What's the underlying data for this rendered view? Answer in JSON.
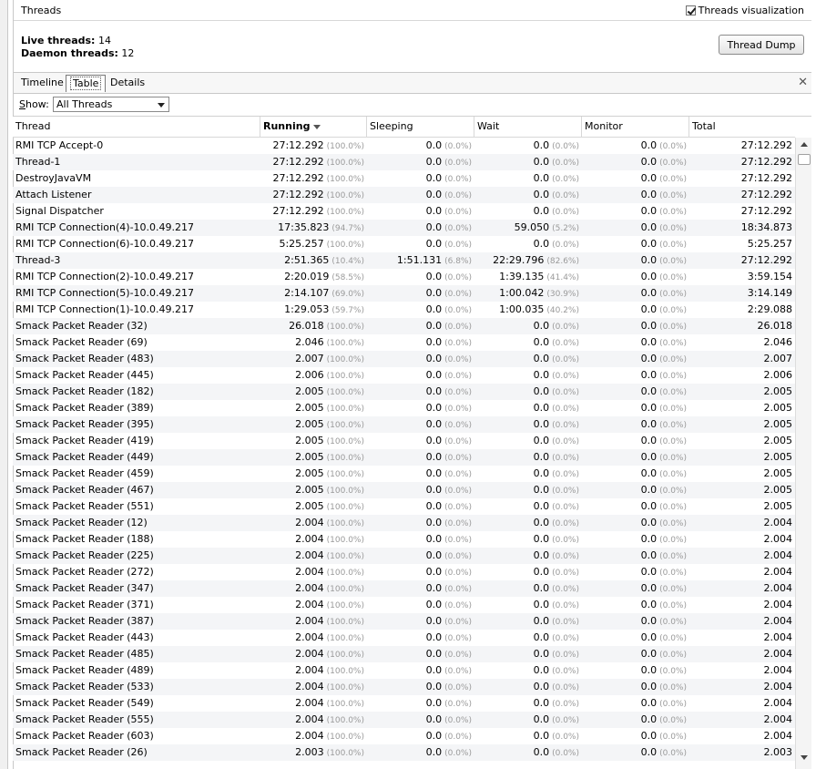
{
  "panel": {
    "title": "Threads",
    "viz_label": "Threads visualization",
    "viz_checked": true
  },
  "summary": {
    "live_label": "Live threads:",
    "live_value": "14",
    "daemon_label": "Daemon threads:",
    "daemon_value": "12"
  },
  "buttons": {
    "thread_dump": "Thread Dump"
  },
  "tabs": [
    "Timeline",
    "Table",
    "Details"
  ],
  "active_tab": "Table",
  "show": {
    "label_prefix": "S",
    "label_rest": "how:",
    "selected": "All Threads"
  },
  "columns": [
    "Thread",
    "Running",
    "Sleeping",
    "Wait",
    "Monitor",
    "Total"
  ],
  "rows": [
    [
      "RMI TCP Accept-0",
      "27:12.292",
      "(100.0%)",
      "0.0",
      "(0.0%)",
      "0.0",
      "(0.0%)",
      "0.0",
      "(0.0%)",
      "27:12.292"
    ],
    [
      "Thread-1",
      "27:12.292",
      "(100.0%)",
      "0.0",
      "(0.0%)",
      "0.0",
      "(0.0%)",
      "0.0",
      "(0.0%)",
      "27:12.292"
    ],
    [
      "DestroyJavaVM",
      "27:12.292",
      "(100.0%)",
      "0.0",
      "(0.0%)",
      "0.0",
      "(0.0%)",
      "0.0",
      "(0.0%)",
      "27:12.292"
    ],
    [
      "Attach Listener",
      "27:12.292",
      "(100.0%)",
      "0.0",
      "(0.0%)",
      "0.0",
      "(0.0%)",
      "0.0",
      "(0.0%)",
      "27:12.292"
    ],
    [
      "Signal Dispatcher",
      "27:12.292",
      "(100.0%)",
      "0.0",
      "(0.0%)",
      "0.0",
      "(0.0%)",
      "0.0",
      "(0.0%)",
      "27:12.292"
    ],
    [
      "RMI TCP Connection(4)-10.0.49.217",
      "17:35.823",
      "(94.7%)",
      "0.0",
      "(0.0%)",
      "59.050",
      "(5.2%)",
      "0.0",
      "(0.0%)",
      "18:34.873"
    ],
    [
      "RMI TCP Connection(6)-10.0.49.217",
      "5:25.257",
      "(100.0%)",
      "0.0",
      "(0.0%)",
      "0.0",
      "(0.0%)",
      "0.0",
      "(0.0%)",
      "5:25.257"
    ],
    [
      "Thread-3",
      "2:51.365",
      "(10.4%)",
      "1:51.131",
      "(6.8%)",
      "22:29.796",
      "(82.6%)",
      "0.0",
      "(0.0%)",
      "27:12.292"
    ],
    [
      "RMI TCP Connection(2)-10.0.49.217",
      "2:20.019",
      "(58.5%)",
      "0.0",
      "(0.0%)",
      "1:39.135",
      "(41.4%)",
      "0.0",
      "(0.0%)",
      "3:59.154"
    ],
    [
      "RMI TCP Connection(5)-10.0.49.217",
      "2:14.107",
      "(69.0%)",
      "0.0",
      "(0.0%)",
      "1:00.042",
      "(30.9%)",
      "0.0",
      "(0.0%)",
      "3:14.149"
    ],
    [
      "RMI TCP Connection(1)-10.0.49.217",
      "1:29.053",
      "(59.7%)",
      "0.0",
      "(0.0%)",
      "1:00.035",
      "(40.2%)",
      "0.0",
      "(0.0%)",
      "2:29.088"
    ],
    [
      "Smack Packet Reader (32)",
      "26.018",
      "(100.0%)",
      "0.0",
      "(0.0%)",
      "0.0",
      "(0.0%)",
      "0.0",
      "(0.0%)",
      "26.018"
    ],
    [
      "Smack Packet Reader (69)",
      "2.046",
      "(100.0%)",
      "0.0",
      "(0.0%)",
      "0.0",
      "(0.0%)",
      "0.0",
      "(0.0%)",
      "2.046"
    ],
    [
      "Smack Packet Reader (483)",
      "2.007",
      "(100.0%)",
      "0.0",
      "(0.0%)",
      "0.0",
      "(0.0%)",
      "0.0",
      "(0.0%)",
      "2.007"
    ],
    [
      "Smack Packet Reader (445)",
      "2.006",
      "(100.0%)",
      "0.0",
      "(0.0%)",
      "0.0",
      "(0.0%)",
      "0.0",
      "(0.0%)",
      "2.006"
    ],
    [
      "Smack Packet Reader (182)",
      "2.005",
      "(100.0%)",
      "0.0",
      "(0.0%)",
      "0.0",
      "(0.0%)",
      "0.0",
      "(0.0%)",
      "2.005"
    ],
    [
      "Smack Packet Reader (389)",
      "2.005",
      "(100.0%)",
      "0.0",
      "(0.0%)",
      "0.0",
      "(0.0%)",
      "0.0",
      "(0.0%)",
      "2.005"
    ],
    [
      "Smack Packet Reader (395)",
      "2.005",
      "(100.0%)",
      "0.0",
      "(0.0%)",
      "0.0",
      "(0.0%)",
      "0.0",
      "(0.0%)",
      "2.005"
    ],
    [
      "Smack Packet Reader (419)",
      "2.005",
      "(100.0%)",
      "0.0",
      "(0.0%)",
      "0.0",
      "(0.0%)",
      "0.0",
      "(0.0%)",
      "2.005"
    ],
    [
      "Smack Packet Reader (449)",
      "2.005",
      "(100.0%)",
      "0.0",
      "(0.0%)",
      "0.0",
      "(0.0%)",
      "0.0",
      "(0.0%)",
      "2.005"
    ],
    [
      "Smack Packet Reader (459)",
      "2.005",
      "(100.0%)",
      "0.0",
      "(0.0%)",
      "0.0",
      "(0.0%)",
      "0.0",
      "(0.0%)",
      "2.005"
    ],
    [
      "Smack Packet Reader (467)",
      "2.005",
      "(100.0%)",
      "0.0",
      "(0.0%)",
      "0.0",
      "(0.0%)",
      "0.0",
      "(0.0%)",
      "2.005"
    ],
    [
      "Smack Packet Reader (551)",
      "2.005",
      "(100.0%)",
      "0.0",
      "(0.0%)",
      "0.0",
      "(0.0%)",
      "0.0",
      "(0.0%)",
      "2.005"
    ],
    [
      "Smack Packet Reader (12)",
      "2.004",
      "(100.0%)",
      "0.0",
      "(0.0%)",
      "0.0",
      "(0.0%)",
      "0.0",
      "(0.0%)",
      "2.004"
    ],
    [
      "Smack Packet Reader (188)",
      "2.004",
      "(100.0%)",
      "0.0",
      "(0.0%)",
      "0.0",
      "(0.0%)",
      "0.0",
      "(0.0%)",
      "2.004"
    ],
    [
      "Smack Packet Reader (225)",
      "2.004",
      "(100.0%)",
      "0.0",
      "(0.0%)",
      "0.0",
      "(0.0%)",
      "0.0",
      "(0.0%)",
      "2.004"
    ],
    [
      "Smack Packet Reader (272)",
      "2.004",
      "(100.0%)",
      "0.0",
      "(0.0%)",
      "0.0",
      "(0.0%)",
      "0.0",
      "(0.0%)",
      "2.004"
    ],
    [
      "Smack Packet Reader (347)",
      "2.004",
      "(100.0%)",
      "0.0",
      "(0.0%)",
      "0.0",
      "(0.0%)",
      "0.0",
      "(0.0%)",
      "2.004"
    ],
    [
      "Smack Packet Reader (371)",
      "2.004",
      "(100.0%)",
      "0.0",
      "(0.0%)",
      "0.0",
      "(0.0%)",
      "0.0",
      "(0.0%)",
      "2.004"
    ],
    [
      "Smack Packet Reader (387)",
      "2.004",
      "(100.0%)",
      "0.0",
      "(0.0%)",
      "0.0",
      "(0.0%)",
      "0.0",
      "(0.0%)",
      "2.004"
    ],
    [
      "Smack Packet Reader (443)",
      "2.004",
      "(100.0%)",
      "0.0",
      "(0.0%)",
      "0.0",
      "(0.0%)",
      "0.0",
      "(0.0%)",
      "2.004"
    ],
    [
      "Smack Packet Reader (485)",
      "2.004",
      "(100.0%)",
      "0.0",
      "(0.0%)",
      "0.0",
      "(0.0%)",
      "0.0",
      "(0.0%)",
      "2.004"
    ],
    [
      "Smack Packet Reader (489)",
      "2.004",
      "(100.0%)",
      "0.0",
      "(0.0%)",
      "0.0",
      "(0.0%)",
      "0.0",
      "(0.0%)",
      "2.004"
    ],
    [
      "Smack Packet Reader (533)",
      "2.004",
      "(100.0%)",
      "0.0",
      "(0.0%)",
      "0.0",
      "(0.0%)",
      "0.0",
      "(0.0%)",
      "2.004"
    ],
    [
      "Smack Packet Reader (549)",
      "2.004",
      "(100.0%)",
      "0.0",
      "(0.0%)",
      "0.0",
      "(0.0%)",
      "0.0",
      "(0.0%)",
      "2.004"
    ],
    [
      "Smack Packet Reader (555)",
      "2.004",
      "(100.0%)",
      "0.0",
      "(0.0%)",
      "0.0",
      "(0.0%)",
      "0.0",
      "(0.0%)",
      "2.004"
    ],
    [
      "Smack Packet Reader (603)",
      "2.004",
      "(100.0%)",
      "0.0",
      "(0.0%)",
      "0.0",
      "(0.0%)",
      "0.0",
      "(0.0%)",
      "2.004"
    ],
    [
      "Smack Packet Reader (26)",
      "2.003",
      "(100.0%)",
      "0.0",
      "(0.0%)",
      "0.0",
      "(0.0%)",
      "0.0",
      "(0.0%)",
      "2.003"
    ]
  ]
}
